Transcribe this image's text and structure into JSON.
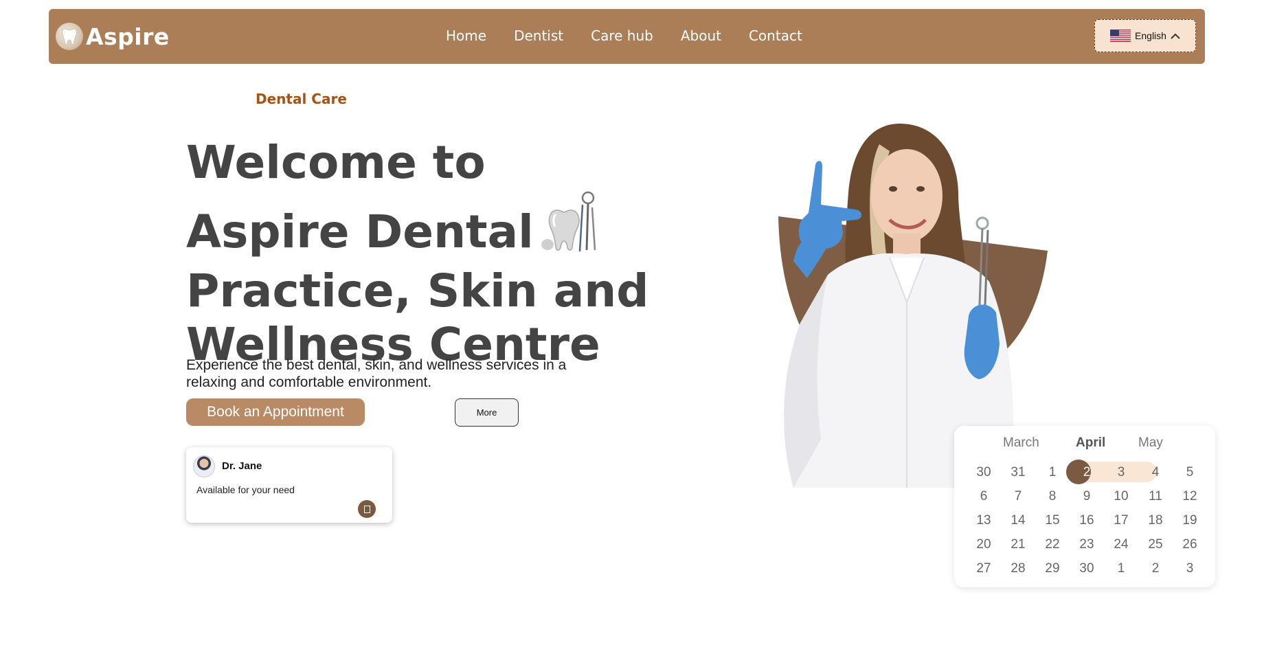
{
  "brand": {
    "name": "Aspire"
  },
  "nav": {
    "links": [
      "Home",
      "Dentist",
      "Care hub",
      "About",
      "Contact"
    ],
    "language": "English"
  },
  "hero": {
    "tagline": "Dental Care",
    "title_lines": [
      "Welcome to",
      "Aspire Dental",
      "Practice, Skin and",
      "Wellness Centre"
    ],
    "subtitle": "Experience the best dental, skin, and wellness services in a relaxing and comfortable environment.",
    "book_button": "Book an Appointment",
    "more_button": "More"
  },
  "doctor_card": {
    "name": "Dr. Jane",
    "status": "Available for your need"
  },
  "calendar": {
    "months": {
      "prev": "March",
      "current": "April",
      "next": "May"
    },
    "weeks": [
      [
        "30",
        "31",
        "1",
        "2",
        "3",
        "4",
        "5"
      ],
      [
        "6",
        "7",
        "8",
        "9",
        "10",
        "11",
        "12"
      ],
      [
        "13",
        "14",
        "15",
        "16",
        "17",
        "18",
        "19"
      ],
      [
        "20",
        "21",
        "22",
        "23",
        "24",
        "25",
        "26"
      ],
      [
        "27",
        "28",
        "29",
        "30",
        "1",
        "2",
        "3"
      ]
    ],
    "selected": "2",
    "range_end": "4"
  },
  "colors": {
    "brand": "#ab7e58",
    "accent_dark": "#7a5a41",
    "tagline": "#a85115",
    "range": "#f9e6d5"
  }
}
